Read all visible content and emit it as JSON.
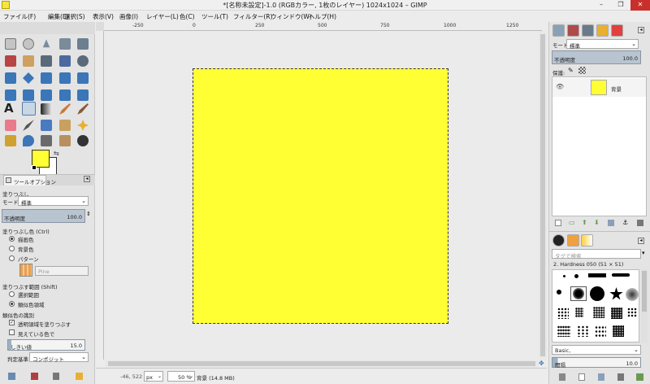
{
  "window": {
    "title": "*[名称未設定]-1.0 (RGBカラー, 1枚のレイヤー) 1024x1024 – GIMP",
    "minimize": "–",
    "maximize": "❐",
    "close": "✕"
  },
  "menu": [
    "ファイル(F)",
    "編集(E)",
    "選択(S)",
    "表示(V)",
    "画像(I)",
    "レイヤー(L)",
    "色(C)",
    "ツール(T)",
    "フィルター(R)",
    "ウィンドウ(W)",
    "ヘルプ(H)"
  ],
  "toolbox": {
    "tool_options_tab": "ツールオプション",
    "tool_name": "塗りつぶし",
    "mode_label": "モード:",
    "mode_value": "標準",
    "opacity_label": "不透明度",
    "opacity_value": "100.0",
    "fill_type_label": "塗りつぶし色 (Ctrl)",
    "fill_type_options": [
      "描画色",
      "背景色",
      "パターン"
    ],
    "pattern_name": "Pine",
    "affected_area_label": "塗りつぶす範囲 (Shift)",
    "affected_area_options": [
      "選択範囲",
      "類似色領域"
    ],
    "similar_colors_label": "類似色の識別",
    "fill_transparent": "透明領域を塗りつぶす",
    "sample_merged": "見えている色で",
    "threshold_label": "しきい値",
    "threshold_value": "15.0",
    "fill_by_label": "判定基準",
    "fill_by_value": "コンポジット"
  },
  "rulers": {
    "top": [
      "-250",
      "0",
      "250",
      "500",
      "750",
      "1000",
      "1250"
    ]
  },
  "status": {
    "coords": "-46, 522",
    "unit": "px",
    "zoom": "50 %",
    "layer_info": "背景 (14.8 MB)"
  },
  "layers": {
    "mode_label": "モード:",
    "mode_value": "標準",
    "opacity_label": "不透明度",
    "opacity_value": "100.0",
    "lock_label": "保護:",
    "layer_name": "背景"
  },
  "brushes": {
    "filter_placeholder": "タグで検索",
    "selected_brush": "2. Hardness 050 (51 × 51)",
    "preset": "Basic,",
    "spacing_label": "間隔",
    "spacing_value": "10.0"
  },
  "colors": {
    "foreground": "#ffff33",
    "background": "#ffffff",
    "image_fill": "#ffff33"
  }
}
